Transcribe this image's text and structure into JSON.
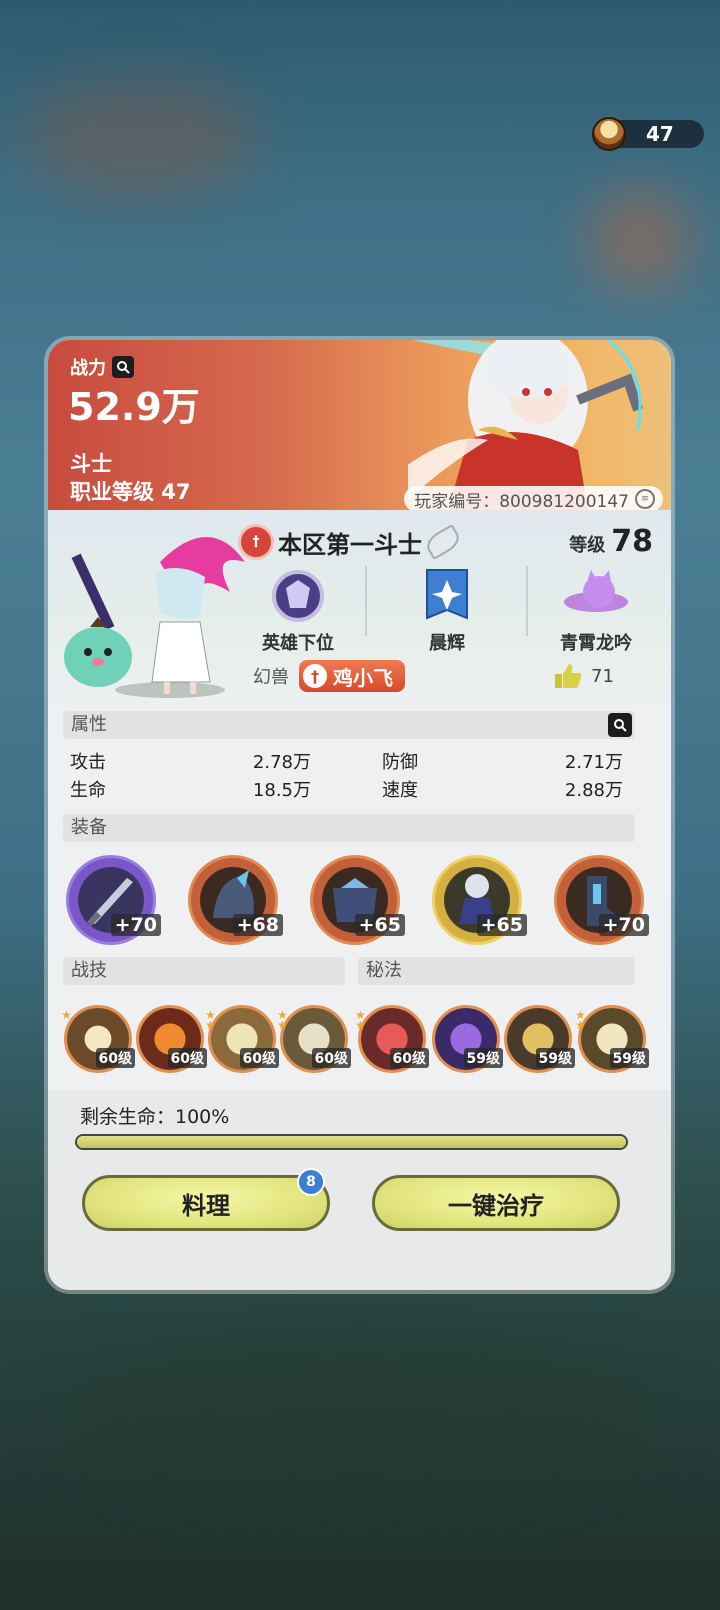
{
  "currency": {
    "value": "47",
    "icon": "food-bowl-icon"
  },
  "hero": {
    "power_label": "战力",
    "power_value": "52.9万",
    "job": "斗士",
    "job_level": "职业等级 47",
    "player_id": "玩家编号：800981200147"
  },
  "profile": {
    "title": "本区第一斗士",
    "level_label": "等级",
    "level_value": "78",
    "badges": [
      {
        "label": "英雄下位",
        "icon": "hero-rank-icon"
      },
      {
        "label": "晨辉",
        "icon": "guild-banner-icon"
      },
      {
        "label": "青霄龙吟",
        "icon": "mount-icon"
      }
    ],
    "pet_label": "幻兽",
    "pet_name": "鸡小飞",
    "likes": "71"
  },
  "attributes": {
    "header": "属性",
    "items": [
      {
        "name": "攻击",
        "value": "2.78万"
      },
      {
        "name": "防御",
        "value": "2.71万"
      },
      {
        "name": "生命",
        "value": "18.5万"
      },
      {
        "name": "速度",
        "value": "2.88万"
      }
    ]
  },
  "equipment": {
    "header": "装备",
    "items": [
      {
        "plus": "+70",
        "rarity": "purple"
      },
      {
        "plus": "+68",
        "rarity": "orange"
      },
      {
        "plus": "+65",
        "rarity": "orange"
      },
      {
        "plus": "+65",
        "rarity": "gold"
      },
      {
        "plus": "+70",
        "rarity": "orange"
      }
    ]
  },
  "skills": {
    "battle_header": "战技",
    "secret_header": "秘法",
    "items": [
      {
        "level": "60级"
      },
      {
        "level": "60级"
      },
      {
        "level": "60级"
      },
      {
        "level": "60级"
      },
      {
        "level": "60级"
      },
      {
        "level": "59级"
      },
      {
        "level": "59级"
      },
      {
        "level": "59级"
      }
    ]
  },
  "status": {
    "hp_label": "剩余生命：100%",
    "hp_fraction": 1.0
  },
  "actions": {
    "cook_label": "料理",
    "cook_badge": "8",
    "heal_label": "一键治疗"
  }
}
